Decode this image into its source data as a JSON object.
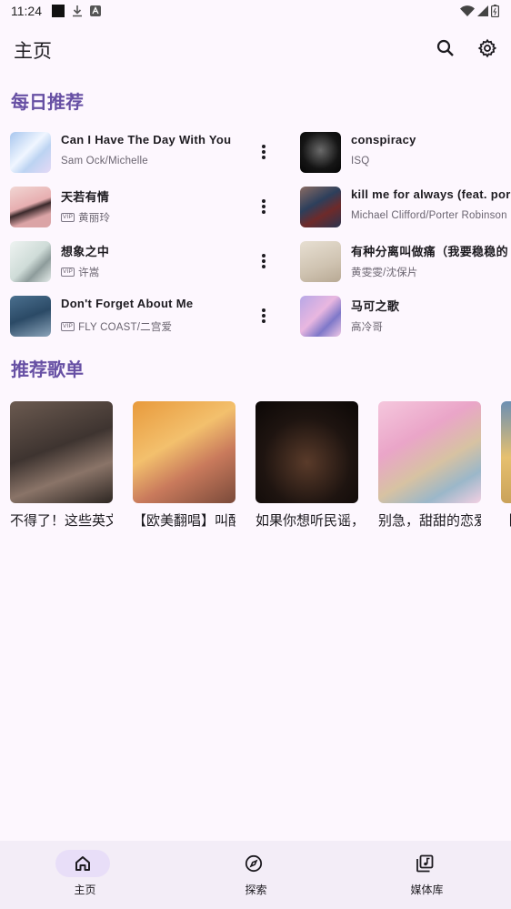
{
  "status_bar": {
    "time": "11:24"
  },
  "app_bar": {
    "title": "主页",
    "search_icon": "search-icon",
    "settings_icon": "gear-icon"
  },
  "daily_recommend": {
    "title": "每日推荐",
    "songs": [
      {
        "title": "Can I Have The Day With You",
        "artist": "Sam Ock/Michelle",
        "vip": false
      },
      {
        "title": "conspiracy",
        "artist": "ISQ",
        "vip": false
      },
      {
        "title": "天若有情",
        "artist": "黄丽玲",
        "vip": true,
        "vip_label": "VIP"
      },
      {
        "title": "kill me for always (feat. por",
        "artist": "Michael Clifford/Porter Robinson",
        "vip": false
      },
      {
        "title": "想象之中",
        "artist": "许嵩",
        "vip": true,
        "vip_label": "VIP"
      },
      {
        "title": "有种分离叫做痛（我要稳稳的",
        "artist": "黄雯雯/沈保片",
        "vip": false
      },
      {
        "title": "Don't Forget About Me",
        "artist": "FLY COAST/二宫爱",
        "vip": true,
        "vip_label": "VIP"
      },
      {
        "title": "马可之歌",
        "artist": "高冷哥",
        "vip": false
      }
    ]
  },
  "recommend_playlists": {
    "title": "推荐歌单",
    "items": [
      {
        "name": "不得了！这些英文"
      },
      {
        "name": "【欧美翻唱】叫醒"
      },
      {
        "name": "如果你想听民谣，"
      },
      {
        "name": "别急，甜甜的恋爱"
      },
      {
        "name": "【"
      }
    ]
  },
  "bottom_nav": {
    "items": [
      {
        "label": "主页",
        "icon": "home-icon",
        "active": true
      },
      {
        "label": "探索",
        "icon": "compass-icon",
        "active": false
      },
      {
        "label": "媒体库",
        "icon": "library-icon",
        "active": false
      }
    ]
  },
  "colors": {
    "accent": "#6750a4",
    "background": "#fdf7fe",
    "nav_background": "#f3edf7",
    "active_pill": "#e8def8"
  }
}
